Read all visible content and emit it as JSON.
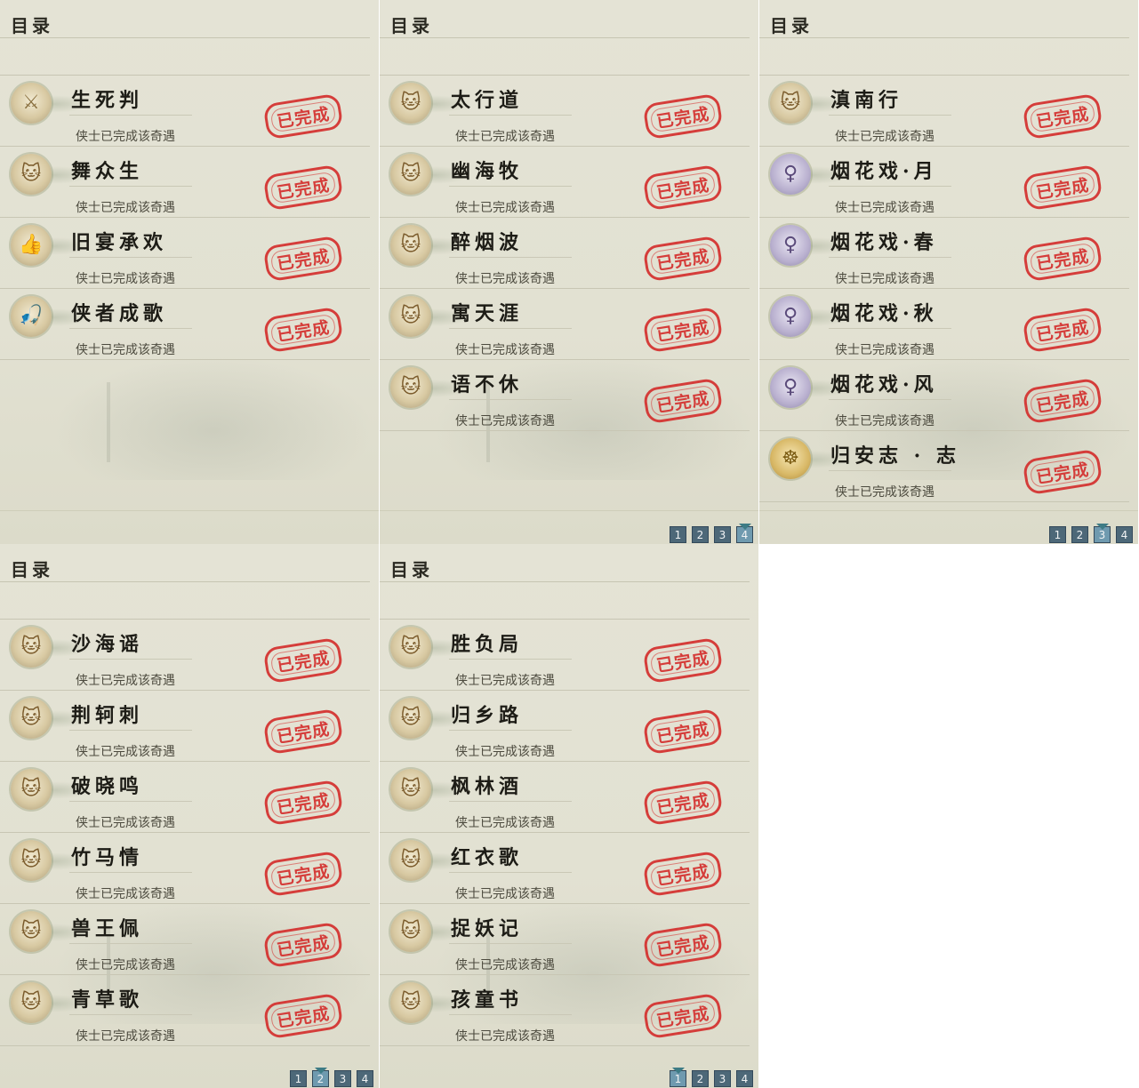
{
  "panels": [
    {
      "title": "目录",
      "entries": [
        {
          "name": "生死判",
          "status": "侠士已完成该奇遇",
          "icon": "blade-icon",
          "seal": "已完成"
        },
        {
          "name": "舞众生",
          "status": "侠士已完成该奇遇",
          "icon": "cat-icon",
          "seal": "已完成"
        },
        {
          "name": "旧宴承欢",
          "status": "侠士已完成该奇遇",
          "icon": "thumb-icon",
          "seal": "已完成"
        },
        {
          "name": "侠者成歌",
          "status": "侠士已完成该奇遇",
          "icon": "fishing-icon",
          "seal": "已完成"
        }
      ],
      "pager": []
    },
    {
      "title": "目录",
      "entries": [
        {
          "name": "太行道",
          "status": "侠士已完成该奇遇",
          "icon": "cat-icon",
          "seal": "已完成"
        },
        {
          "name": "幽海牧",
          "status": "侠士已完成该奇遇",
          "icon": "cat-icon",
          "seal": "已完成"
        },
        {
          "name": "醉烟波",
          "status": "侠士已完成该奇遇",
          "icon": "cat-icon",
          "seal": "已完成"
        },
        {
          "name": "寓天涯",
          "status": "侠士已完成该奇遇",
          "icon": "cat-icon",
          "seal": "已完成"
        },
        {
          "name": "语不休",
          "status": "侠士已完成该奇遇",
          "icon": "cat-icon",
          "seal": "已完成"
        }
      ],
      "pager": [
        "1",
        "2",
        "3",
        "4"
      ],
      "active_page": "4"
    },
    {
      "title": "目录",
      "entries": [
        {
          "name": "滇南行",
          "status": "侠士已完成该奇遇",
          "icon": "cat-icon",
          "seal": "已完成"
        },
        {
          "name": "烟花戏·月",
          "status": "侠士已完成该奇遇",
          "icon": "lady-icon",
          "seal": "已完成"
        },
        {
          "name": "烟花戏·春",
          "status": "侠士已完成该奇遇",
          "icon": "lady-icon",
          "seal": "已完成"
        },
        {
          "name": "烟花戏·秋",
          "status": "侠士已完成该奇遇",
          "icon": "lady-icon",
          "seal": "已完成"
        },
        {
          "name": "烟花戏·风",
          "status": "侠士已完成该奇遇",
          "icon": "lady-icon",
          "seal": "已完成"
        },
        {
          "name": "归安志 · 志",
          "status": "侠士已完成该奇遇",
          "icon": "buddha-icon",
          "seal": "已完成"
        }
      ],
      "pager": [
        "1",
        "2",
        "3",
        "4"
      ],
      "active_page": "3"
    },
    {
      "title": "目录",
      "entries": [
        {
          "name": "沙海谣",
          "status": "侠士已完成该奇遇",
          "icon": "cat-icon",
          "seal": "已完成"
        },
        {
          "name": "荆轲刺",
          "status": "侠士已完成该奇遇",
          "icon": "cat-icon",
          "seal": "已完成"
        },
        {
          "name": "破晓鸣",
          "status": "侠士已完成该奇遇",
          "icon": "cat-icon",
          "seal": "已完成"
        },
        {
          "name": "竹马情",
          "status": "侠士已完成该奇遇",
          "icon": "cat-icon",
          "seal": "已完成"
        },
        {
          "name": "兽王佩",
          "status": "侠士已完成该奇遇",
          "icon": "cat-icon",
          "seal": "已完成"
        },
        {
          "name": "青草歌",
          "status": "侠士已完成该奇遇",
          "icon": "cat-icon",
          "seal": "已完成"
        }
      ],
      "pager": [
        "1",
        "2",
        "3",
        "4"
      ],
      "active_page": "2"
    },
    {
      "title": "目录",
      "entries": [
        {
          "name": "胜负局",
          "status": "侠士已完成该奇遇",
          "icon": "cat-icon",
          "seal": "已完成"
        },
        {
          "name": "归乡路",
          "status": "侠士已完成该奇遇",
          "icon": "cat-icon",
          "seal": "已完成"
        },
        {
          "name": "枫林酒",
          "status": "侠士已完成该奇遇",
          "icon": "cat-icon",
          "seal": "已完成"
        },
        {
          "name": "红衣歌",
          "status": "侠士已完成该奇遇",
          "icon": "cat-icon",
          "seal": "已完成"
        },
        {
          "name": "捉妖记",
          "status": "侠士已完成该奇遇",
          "icon": "cat-icon",
          "seal": "已完成"
        },
        {
          "name": "孩童书",
          "status": "侠士已完成该奇遇",
          "icon": "cat-icon",
          "seal": "已完成"
        }
      ],
      "pager": [
        "1",
        "2",
        "3",
        "4"
      ],
      "active_page": "1"
    }
  ]
}
